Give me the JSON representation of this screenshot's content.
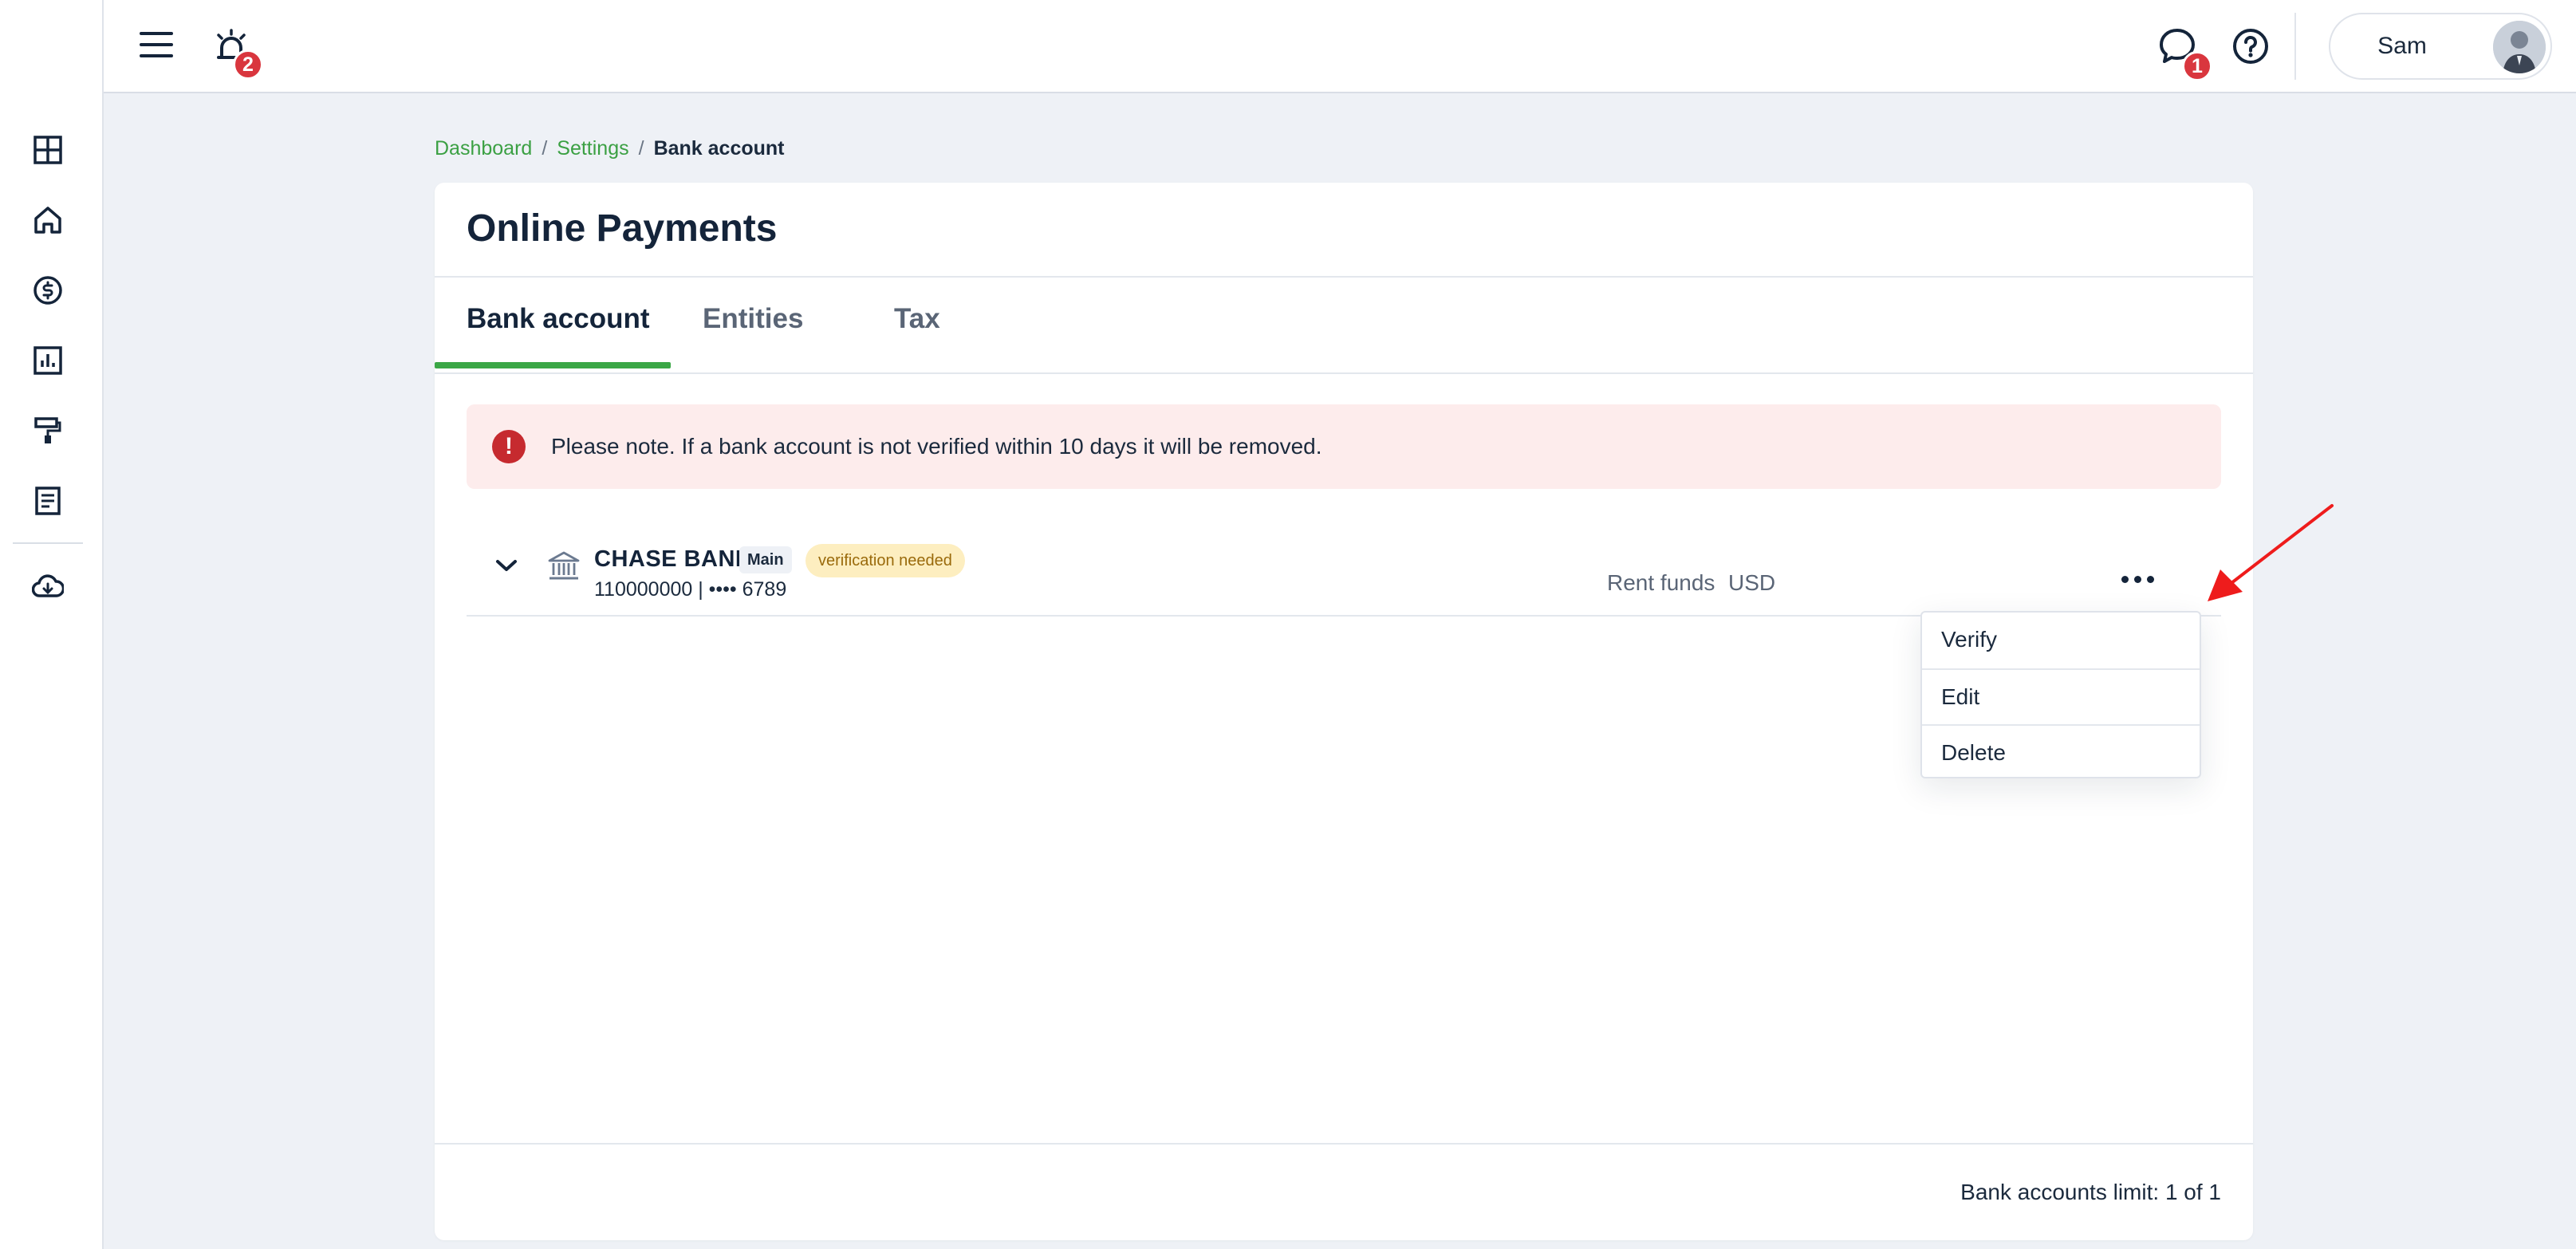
{
  "topbar": {
    "notifications_badge": "2",
    "messages_badge": "1",
    "user_name": "Sam"
  },
  "sidebar": {
    "items": [
      {
        "icon": "dashboard-icon"
      },
      {
        "icon": "home-icon"
      },
      {
        "icon": "dollar-icon"
      },
      {
        "icon": "reports-icon"
      },
      {
        "icon": "paint-roller-icon"
      },
      {
        "icon": "document-icon"
      },
      {
        "icon": "cloud-download-icon"
      }
    ]
  },
  "breadcrumb": {
    "items": [
      "Dashboard",
      "Settings"
    ],
    "current": "Bank account",
    "separator": "/"
  },
  "page": {
    "title": "Online Payments",
    "tabs": [
      {
        "label": "Bank account",
        "active": true
      },
      {
        "label": "Entities",
        "active": false
      },
      {
        "label": "Tax",
        "active": false
      }
    ]
  },
  "alert": {
    "icon_text": "!",
    "text": "Please note. If a bank account is not verified within 10 days it will be removed."
  },
  "account": {
    "bank_name": "CHASE BANK",
    "main_tag": "Main",
    "status_tag": "verification needed",
    "account_number": "110000000 | •••• 6789",
    "purpose": "Rent funds",
    "currency": "USD"
  },
  "menu": {
    "items": [
      "Verify",
      "Edit",
      "Delete"
    ]
  },
  "footer": {
    "limit_text": "Bank accounts limit: 1 of 1"
  },
  "colors": {
    "accent_green": "#3aa746",
    "badge_red": "#d9363e",
    "alert_bg": "#fdecec",
    "annotation_arrow": "#ee1c1c"
  }
}
